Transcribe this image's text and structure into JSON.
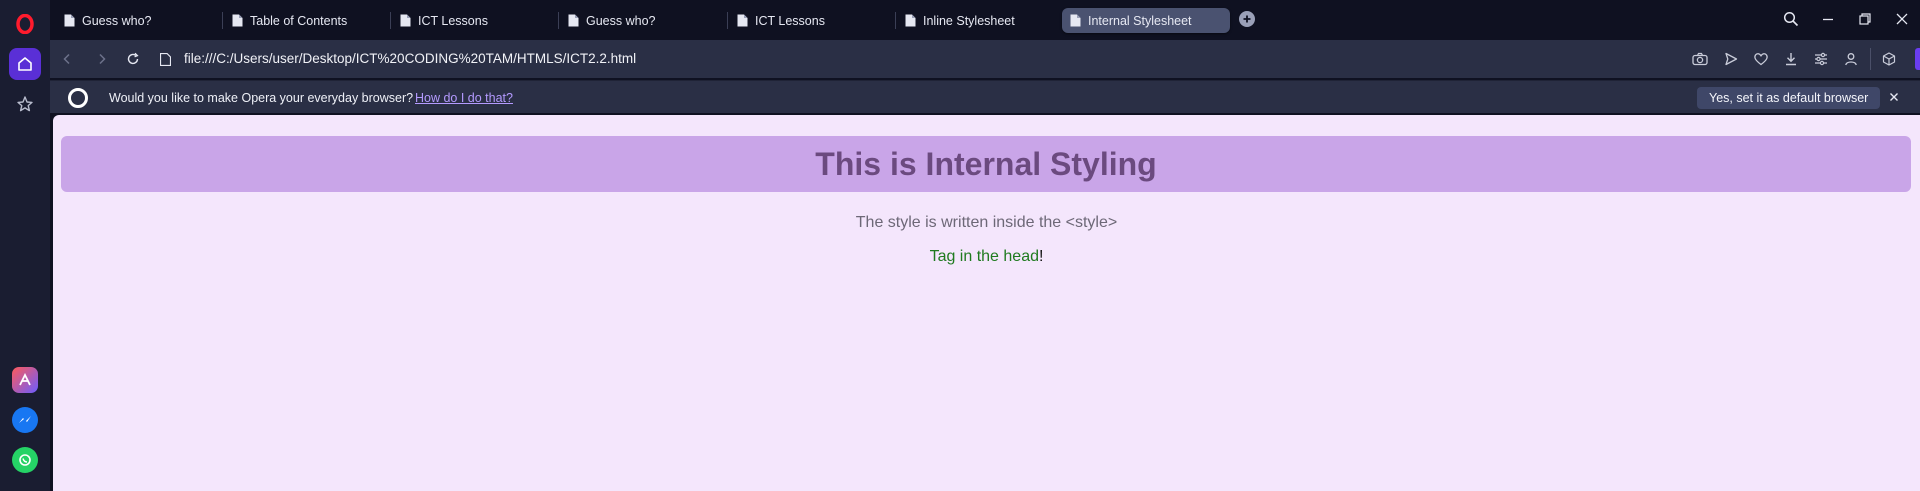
{
  "browser": {
    "tabs": [
      {
        "label": "Guess who?"
      },
      {
        "label": "Table of Contents"
      },
      {
        "label": "ICT Lessons"
      },
      {
        "label": "Guess who?"
      },
      {
        "label": "ICT Lessons"
      },
      {
        "label": "Inline Stylesheet"
      },
      {
        "label": "Internal Stylesheet",
        "active": true
      }
    ],
    "url": "file:///C:/Users/user/Desktop/ICT%20CODING%20TAM/HTMLS/ICT2.2.html"
  },
  "infobar": {
    "message": "Would you like to make Opera your everyday browser?",
    "link": "How do I do that?",
    "button": "Yes, set it as default browser"
  },
  "page": {
    "heading": "This is Internal Styling",
    "line1": "The style is written inside the <style>",
    "line2_main": "Tag in the head",
    "line2_end": "!"
  },
  "colors": {
    "sidebar_accent": "#5a2fd6",
    "page_background": "#f4e6fc",
    "heading_background": "#c9a5e8",
    "heading_text": "#6b4a7f",
    "paragraph_grey": "#6d6877",
    "paragraph_green": "#1f7a1f"
  },
  "icons": [
    "opera-logo-icon",
    "home-icon",
    "star-icon",
    "aria-icon",
    "messenger-icon",
    "whatsapp-icon",
    "document-icon",
    "plus-icon",
    "search-icon",
    "minimize-icon",
    "restore-icon",
    "close-icon",
    "back-icon",
    "forward-icon",
    "reload-icon",
    "page-info-icon",
    "camera-icon",
    "send-icon",
    "heart-icon",
    "download-icon",
    "easy-setup-icon",
    "profile-icon",
    "extensions-icon"
  ]
}
